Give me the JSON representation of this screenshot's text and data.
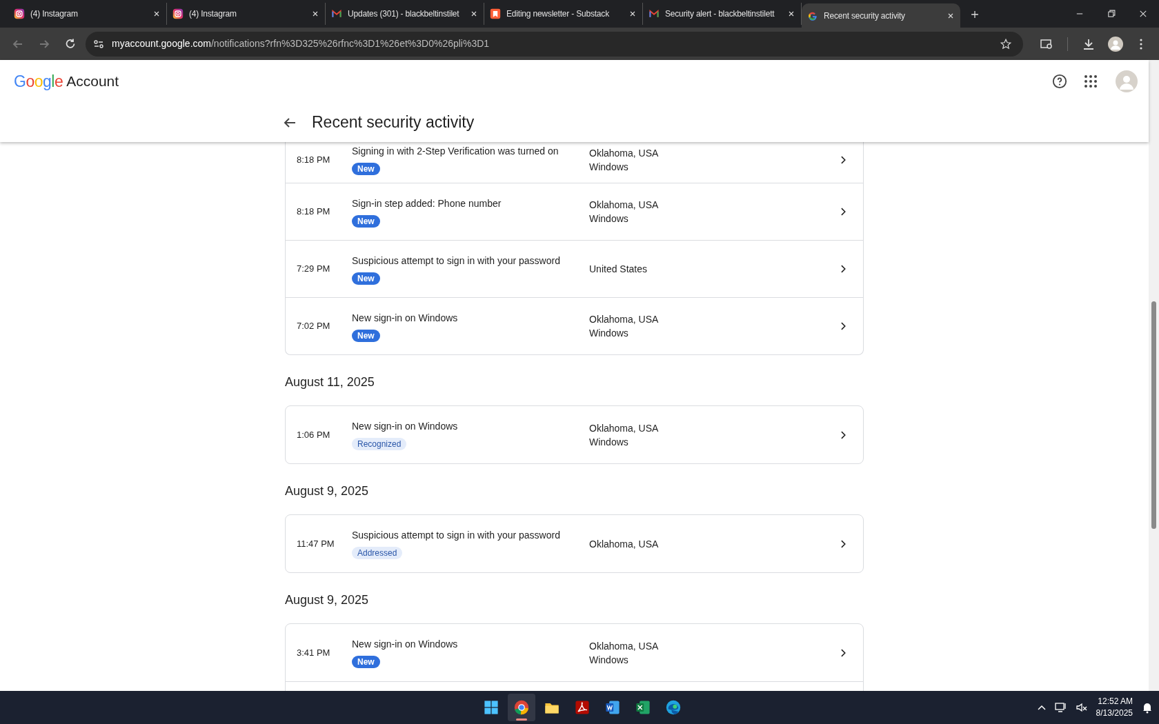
{
  "browser": {
    "tabs": [
      {
        "title": "(4) Instagram",
        "kind": "instagram",
        "selected": false
      },
      {
        "title": "(4) Instagram",
        "kind": "instagram",
        "selected": false
      },
      {
        "title": "Updates (301) - blackbeltinstilet",
        "kind": "mail",
        "selected": false
      },
      {
        "title": "Editing newsletter - Substack",
        "kind": "bookmark",
        "selected": false
      },
      {
        "title": "Security alert - blackbeltinstilett",
        "kind": "mail",
        "selected": false
      },
      {
        "title": "Recent security activity",
        "kind": "g",
        "selected": true
      }
    ],
    "url": {
      "host": "myaccount.google.com",
      "path": "/notifications?rfn%3D325%26rfnc%3D1%26et%3D0%26pli%3D1"
    }
  },
  "header": {
    "logo": "Google",
    "product": "Account",
    "page_title": "Recent security activity"
  },
  "sections": [
    {
      "rows": [
        {
          "time": "8:18 PM",
          "title": "Signing in with 2-Step Verification was turned on",
          "badge": {
            "label": "New",
            "kind": "new"
          },
          "location": [
            "Oklahoma, USA",
            "Windows"
          ]
        },
        {
          "time": "8:18 PM",
          "title": "Sign-in step added: Phone number",
          "badge": {
            "label": "New",
            "kind": "new"
          },
          "location": [
            "Oklahoma, USA",
            "Windows"
          ]
        },
        {
          "time": "7:29 PM",
          "title": "Suspicious attempt to sign in with your password",
          "badge": {
            "label": "New",
            "kind": "new"
          },
          "location": [
            "United States"
          ]
        },
        {
          "time": "7:02 PM",
          "title": "New sign-in on Windows",
          "badge": {
            "label": "New",
            "kind": "new"
          },
          "location": [
            "Oklahoma, USA",
            "Windows"
          ]
        }
      ]
    },
    {
      "date": "August 11, 2025",
      "rows": [
        {
          "time": "1:06 PM",
          "title": "New sign-in on Windows",
          "badge": {
            "label": "Recognized",
            "kind": "muted"
          },
          "location": [
            "Oklahoma, USA",
            "Windows"
          ]
        }
      ]
    },
    {
      "date": "August 9, 2025",
      "rows": [
        {
          "time": "11:47 PM",
          "title": "Suspicious attempt to sign in with your password",
          "badge": {
            "label": "Addressed",
            "kind": "muted"
          },
          "location": [
            "Oklahoma, USA"
          ]
        }
      ]
    },
    {
      "date": "August 9, 2025",
      "rows": [
        {
          "time": "3:41 PM",
          "title": "New sign-in on Windows",
          "badge": {
            "label": "New",
            "kind": "new"
          },
          "location": [
            "Oklahoma, USA",
            "Windows"
          ]
        }
      ],
      "more": true
    }
  ],
  "taskbar": {
    "apps": [
      {
        "kind": "start",
        "selected": false
      },
      {
        "kind": "browser",
        "selected": true
      },
      {
        "kind": "folder",
        "selected": false
      },
      {
        "kind": "pdf",
        "selected": false
      },
      {
        "kind": "doc",
        "selected": false
      },
      {
        "kind": "sheet",
        "selected": false
      },
      {
        "kind": "edge",
        "selected": false
      }
    ],
    "time": "12:52 AM",
    "date": "8/13/2025"
  }
}
